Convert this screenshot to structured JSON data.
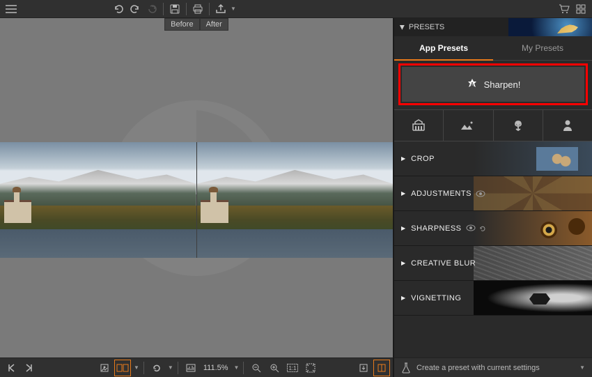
{
  "top_toolbar": {
    "menu": "menu",
    "undo": "undo",
    "redo": "redo",
    "redo2": "redo-forward",
    "save": "save",
    "print": "print",
    "share": "share",
    "cart": "cart",
    "grid": "grid"
  },
  "compare": {
    "before": "Before",
    "after": "After"
  },
  "right_panel": {
    "header": "PRESETS",
    "tabs": {
      "app": "App Presets",
      "my": "My Presets"
    },
    "sharpen": "Sharpen!",
    "categories": [
      "architecture",
      "landscape",
      "macro",
      "portrait"
    ],
    "sections": [
      {
        "label": "CROP",
        "icons": []
      },
      {
        "label": "ADJUSTMENTS",
        "icons": [
          "eye"
        ]
      },
      {
        "label": "SHARPNESS",
        "icons": [
          "eye",
          "undo"
        ]
      },
      {
        "label": "CREATIVE BLUR",
        "icons": []
      },
      {
        "label": "VIGNETTING",
        "icons": []
      }
    ]
  },
  "bottom": {
    "zoom": "111.5%",
    "create_preset": "Create a preset with current settings"
  }
}
